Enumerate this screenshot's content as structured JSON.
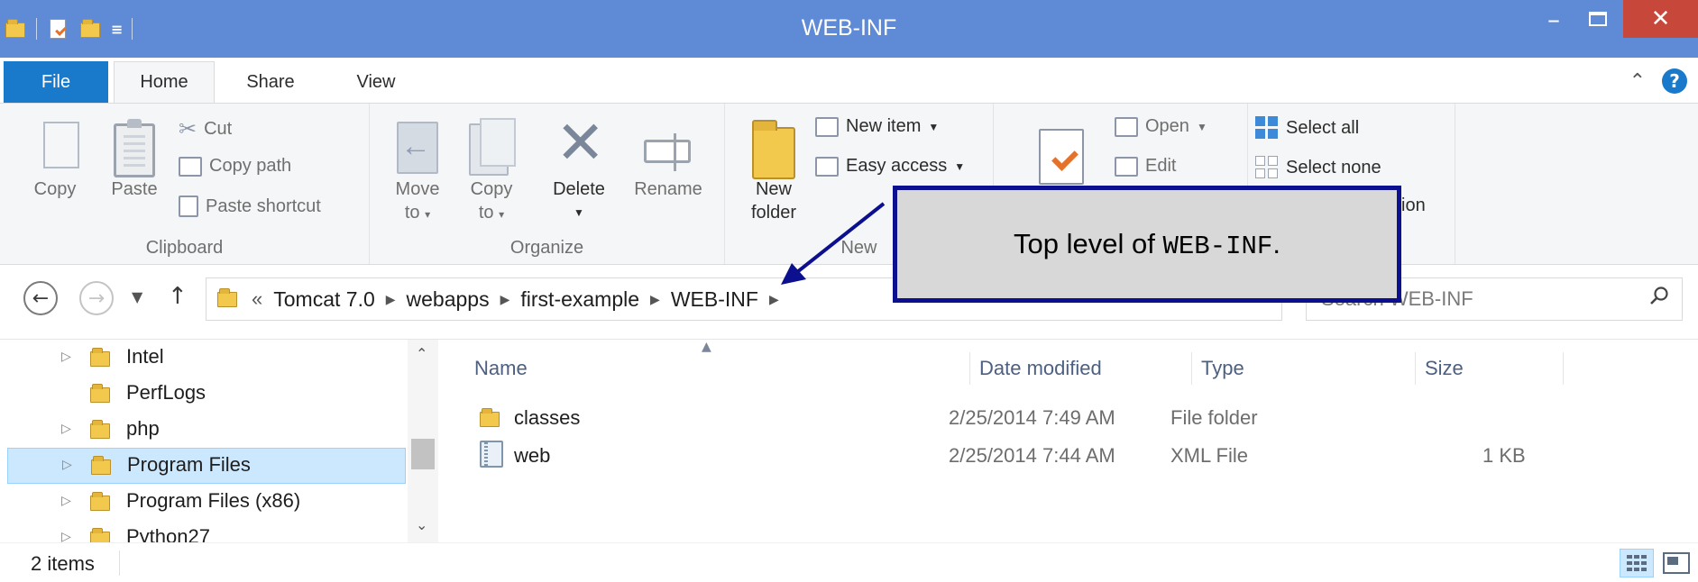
{
  "window": {
    "title": "WEB-INF"
  },
  "ribbon_tabs": [
    "File",
    "Home",
    "Share",
    "View"
  ],
  "ribbon": {
    "clipboard": {
      "copy": "Copy",
      "paste": "Paste",
      "cut": "Cut",
      "copy_path": "Copy path",
      "paste_shortcut": "Paste shortcut",
      "label": "Clipboard"
    },
    "organize": {
      "move_to": [
        "Move",
        "to"
      ],
      "copy_to": [
        "Copy",
        "to"
      ],
      "delete": "Delete",
      "rename": "Rename",
      "label": "Organize"
    },
    "new": {
      "new_folder": [
        "New",
        "folder"
      ],
      "new_item": "New item",
      "easy_access": "Easy access",
      "label": "New"
    },
    "open": {
      "open": "Open",
      "edit": "Edit"
    },
    "select": {
      "select_all": "Select all",
      "select_none": "Select none",
      "invert_partial": "ion"
    }
  },
  "address": {
    "lead": "«",
    "breadcrumbs": [
      "Tomcat 7.0",
      "webapps",
      "first-example",
      "WEB-INF"
    ],
    "search_placeholder": "Search WEB-INF"
  },
  "navigation_tree": [
    {
      "label": "Intel",
      "expandable": true,
      "selected": false
    },
    {
      "label": "PerfLogs",
      "expandable": false,
      "selected": false
    },
    {
      "label": "php",
      "expandable": true,
      "selected": false
    },
    {
      "label": "Program Files",
      "expandable": true,
      "selected": true
    },
    {
      "label": "Program Files (x86)",
      "expandable": true,
      "selected": false
    },
    {
      "label": "Python27",
      "expandable": true,
      "selected": false
    }
  ],
  "file_list": {
    "columns": [
      "Name",
      "Date modified",
      "Type",
      "Size"
    ],
    "rows": [
      {
        "name": "classes",
        "date_modified": "2/25/2014 7:49 AM",
        "type": "File folder",
        "size": "",
        "icon": "folder-icon"
      },
      {
        "name": "web",
        "date_modified": "2/25/2014 7:44 AM",
        "type": "XML File",
        "size": "1 KB",
        "icon": "xml-file-icon"
      }
    ]
  },
  "status": {
    "item_count": "2 items"
  },
  "callout": {
    "text_prefix": "Top level of ",
    "code": "WEB-INF",
    "text_suffix": "."
  },
  "colors": {
    "titlebar": "#5e8ad6",
    "file_tab": "#1979ca",
    "close_button": "#c7473b",
    "selection": "#cce8ff",
    "callout_border": "#0c0f8e",
    "callout_fill": "#d8d8d8"
  }
}
